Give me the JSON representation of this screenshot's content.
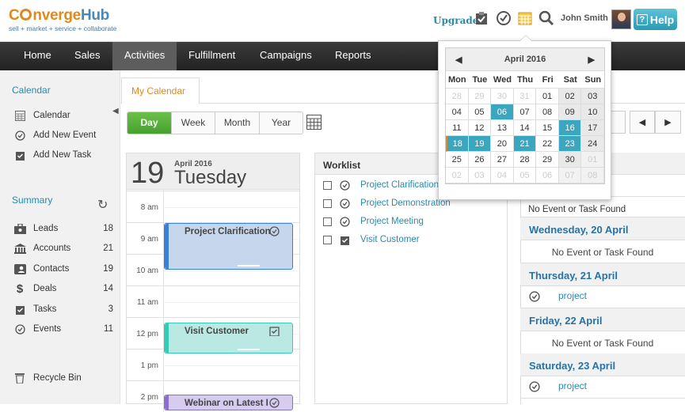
{
  "app": {
    "brand": "ConvergeHub",
    "brand_part1": "C",
    "brand_part2": "nverge",
    "brand_part3": "Hub",
    "tagline": "sell + market + service + collaborate"
  },
  "header": {
    "upgrade": "Upgrade",
    "user": "John Smith",
    "help": "Help",
    "help_q": "?",
    "icons": [
      "task-icon",
      "event-icon",
      "calendar-icon",
      "search-icon"
    ]
  },
  "nav": [
    "Home",
    "Sales",
    "Activities",
    "Fulfillment",
    "Campaigns",
    "Reports"
  ],
  "nav_active": "Activities",
  "sidebar": {
    "calendar_head": "Calendar",
    "calendar_items": [
      "Calendar",
      "Add New Event",
      "Add New Task"
    ],
    "summary_head": "Summary",
    "summary": [
      {
        "label": "Leads",
        "count": "18",
        "icon": "leads-icon"
      },
      {
        "label": "Accounts",
        "count": "21",
        "icon": "accounts-icon"
      },
      {
        "label": "Contacts",
        "count": "19",
        "icon": "contacts-icon"
      },
      {
        "label": "Deals",
        "count": "14",
        "icon": "deals-icon"
      },
      {
        "label": "Tasks",
        "count": "3",
        "icon": "tasks-icon"
      },
      {
        "label": "Events",
        "count": "11",
        "icon": "events-icon"
      }
    ],
    "recycle": "Recycle Bin"
  },
  "tab": "My Calendar",
  "views": [
    "Day",
    "Week",
    "Month",
    "Year"
  ],
  "active_view": "Day",
  "day": {
    "num": "19",
    "month": "April 2016",
    "name": "Tuesday",
    "hours": [
      "8 am",
      "9 am",
      "10 am",
      "11 am",
      "12 pm",
      "1 pm",
      "2 pm"
    ],
    "events": [
      {
        "title": "Project Clarification",
        "color": "#3a7fd8",
        "bg": "#c6d6ec"
      },
      {
        "title": "Visit Customer",
        "color": "#33cbb8",
        "bg": "#b9e9e2"
      },
      {
        "title": "Webinar on Latest I",
        "color": "#8a6fd0",
        "bg": "#d6ccef"
      }
    ]
  },
  "worklist": {
    "title": "Worklist",
    "items": [
      {
        "label": "Project Clarification",
        "icon": "event-icon"
      },
      {
        "label": "Project Demonstration",
        "icon": "event-icon"
      },
      {
        "label": "Project Meeting",
        "icon": "event-icon"
      },
      {
        "label": "Visit Customer",
        "icon": "task-icon"
      }
    ]
  },
  "agenda": {
    "first_none": "No Event or Task Found",
    "days": [
      {
        "date": "Wednesday, 20 April",
        "entry": "No Event or Task Found",
        "type": "none"
      },
      {
        "date": "Thursday, 21 April",
        "entry": "project",
        "type": "item"
      },
      {
        "date": "Friday, 22 April",
        "entry": "No Event or Task Found",
        "type": "none"
      },
      {
        "date": "Saturday, 23 April",
        "entry": "project",
        "type": "item"
      }
    ]
  },
  "minical": {
    "title": "April 2016",
    "prev": "◀",
    "next": "▶",
    "dow": [
      "Mon",
      "Tue",
      "Wed",
      "Thu",
      "Fri",
      "Sat",
      "Sun"
    ],
    "weeks": [
      [
        "28",
        "29",
        "30",
        "31",
        "01",
        "02",
        "03"
      ],
      [
        "04",
        "05",
        "06",
        "07",
        "08",
        "09",
        "10"
      ],
      [
        "11",
        "12",
        "13",
        "14",
        "15",
        "16",
        "17"
      ],
      [
        "18",
        "19",
        "20",
        "21",
        "22",
        "23",
        "24"
      ],
      [
        "25",
        "26",
        "27",
        "28",
        "29",
        "30",
        "01"
      ],
      [
        "02",
        "03",
        "04",
        "05",
        "06",
        "07",
        "08"
      ]
    ],
    "highlighted": [
      "06",
      "16",
      "19",
      "21",
      "23"
    ],
    "today": "18"
  },
  "colors": {
    "accent": "#3aa6c0",
    "brand_orange": "#e08a1e",
    "link": "#2a8aa8",
    "nav_bg": "#2d2d2d"
  }
}
